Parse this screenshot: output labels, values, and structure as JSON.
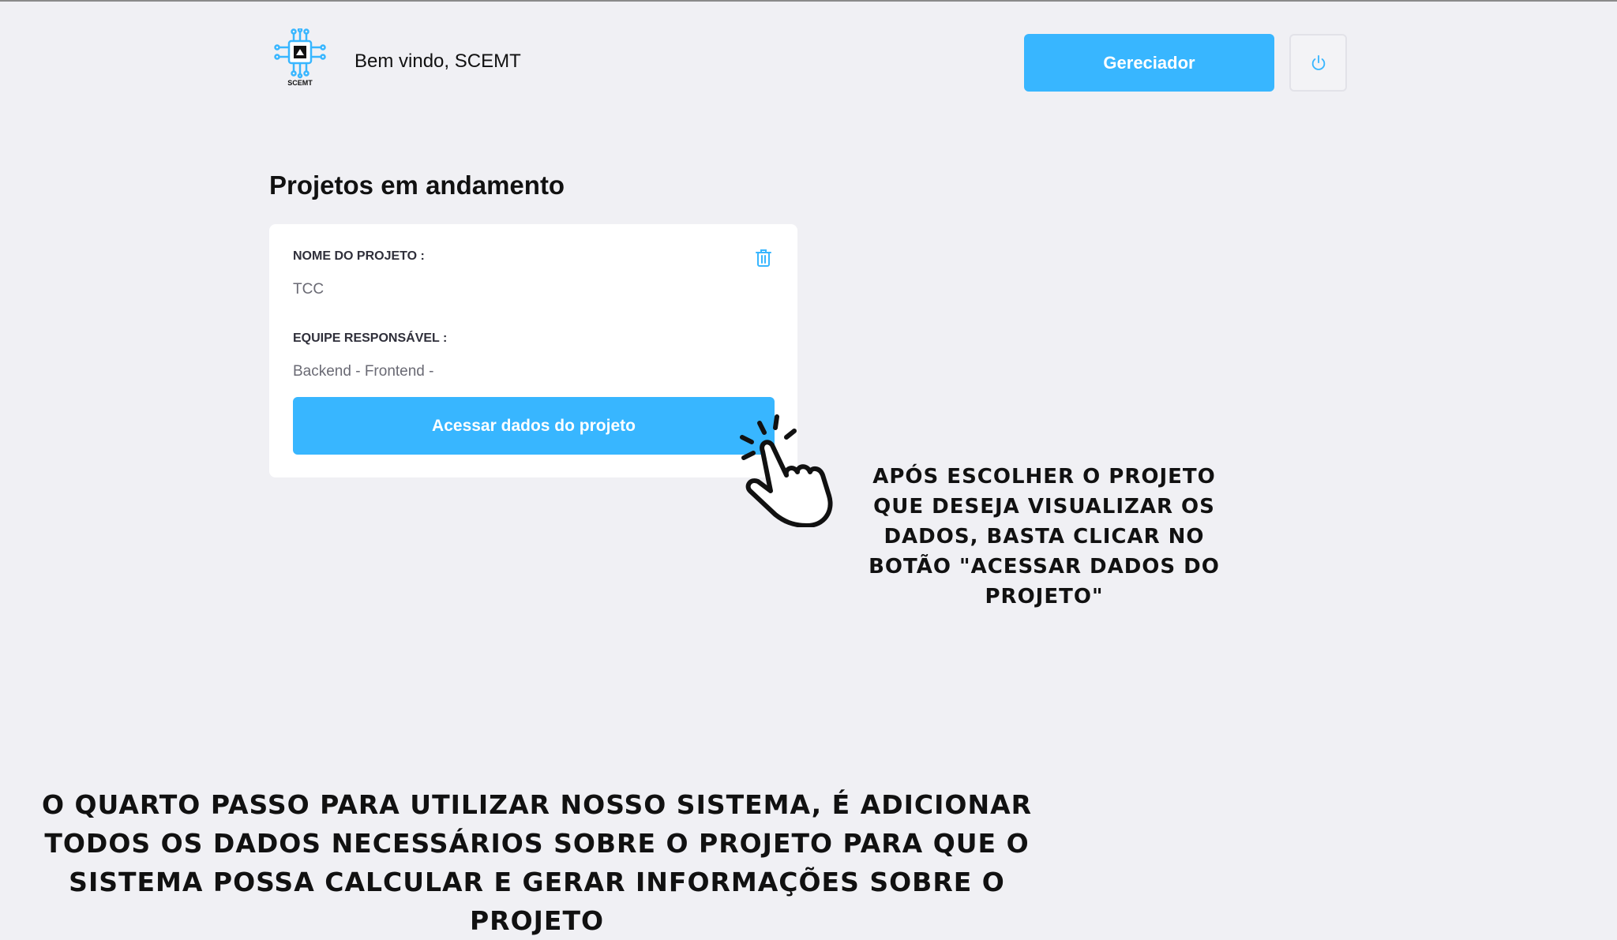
{
  "header": {
    "logo_text": "SCEMT",
    "welcome": "Bem vindo, SCEMT",
    "manager_button": "Gereciador",
    "power_icon": "power-icon"
  },
  "main": {
    "section_title": "Projetos em andamento",
    "project_card": {
      "name_label": "NOME DO PROJETO :",
      "name_value": "TCC",
      "team_label": "EQUIPE RESPONSÁVEL :",
      "team_value": "Backend - Frontend -",
      "access_button": "Acessar dados do projeto",
      "delete_icon": "trash-icon"
    }
  },
  "annotations": {
    "callout": "APÓS ESCOLHER O PROJETO QUE DESEJA VISUALIZAR OS DADOS, BASTA CLICAR NO BOTÃO \"ACESSAR DADOS DO PROJETO\"",
    "footer": "O QUARTO PASSO PARA UTILIZAR NOSSO SISTEMA, É ADICIONAR TODOS OS DADOS NECESSÁRIOS SOBRE O PROJETO PARA QUE O SISTEMA POSSA CALCULAR E GERAR INFORMAÇÕES SOBRE O PROJETO",
    "pointer_icon": "hand-click-icon"
  },
  "colors": {
    "accent": "#38b6ff",
    "background": "#f0f0f4",
    "card": "#ffffff"
  }
}
